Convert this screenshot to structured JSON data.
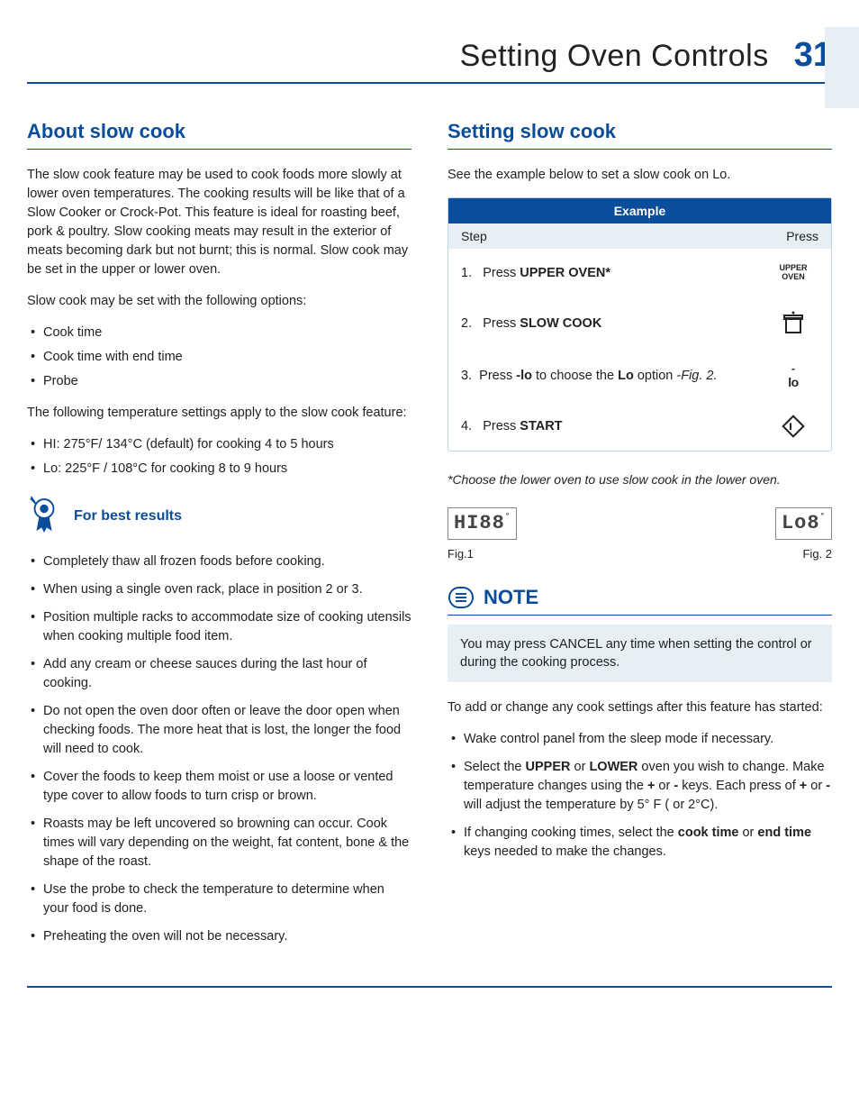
{
  "header": {
    "title": "Setting Oven Controls",
    "page_number": "31"
  },
  "left": {
    "section_title": "About slow cook",
    "intro": "The slow cook feature may be used to cook foods more slowly at lower oven temperatures. The cooking results will be like that of a Slow Cooker or Crock-Pot. This feature is ideal for roasting beef, pork & poultry. Slow cooking meats may result in the exterior of meats becoming dark but not burnt; this is normal. Slow cook may be set in the upper or lower oven.",
    "options_intro": "Slow cook may be set with the following options:",
    "options": [
      "Cook time",
      "Cook time with end time",
      "Probe"
    ],
    "temps_intro": "The following temperature settings apply to the slow cook feature:",
    "temps": [
      "HI: 275°F/ 134°C (default) for cooking 4 to 5 hours",
      "Lo: 225°F / 108°C for cooking 8 to 9 hours"
    ],
    "best_results_title": "For best results",
    "best_results": [
      "Completely thaw all frozen foods before cooking.",
      "When using a single oven rack, place in position 2 or 3.",
      "Position multiple racks to accommodate size of cooking utensils when cooking multiple food item.",
      "Add any cream or cheese sauces during the last hour of cooking.",
      "Do not open the oven door often or leave the door open when checking foods. The more heat that is lost, the longer the food will need to cook.",
      "Cover the foods to keep them moist or use a loose or vented type cover to allow foods to turn crisp or brown.",
      "Roasts may be left uncovered so browning can occur. Cook times will vary depending on the weight, fat content, bone & the shape of the roast.",
      "Use the probe to check the temperature to determine when your food is done.",
      "Preheating the oven will not be necessary."
    ]
  },
  "right": {
    "section_title": "Setting slow cook",
    "intro": "See the example below to set a slow cook on Lo.",
    "table": {
      "title": "Example",
      "col_step": "Step",
      "col_press": "Press",
      "rows": {
        "r1_num": "1.",
        "r1_prefix": "Press ",
        "r1_bold": "UPPER OVEN*",
        "r1_btn_l1": "UPPER",
        "r1_btn_l2": "OVEN",
        "r2_num": "2.",
        "r2_prefix": "Press ",
        "r2_bold": "SLOW COOK",
        "r3_num": "3.",
        "r3_prefix": "Press ",
        "r3_bold1": "-lo",
        "r3_mid": "  to choose the ",
        "r3_bold2": "Lo",
        "r3_suffix": " option ",
        "r3_italic": "-Fig. 2.",
        "r3_btn_top": "-",
        "r3_btn": "lo",
        "r4_num": "4.",
        "r4_prefix": "Press ",
        "r4_bold": "START"
      }
    },
    "footnote": "*Choose the lower oven to use slow cook in the lower oven.",
    "fig1_display": "HI88",
    "fig1_label": "Fig.1",
    "fig2_display": "Lo8",
    "fig2_label": "Fig. 2",
    "note_title": "NOTE",
    "note_body": "You may press CANCEL any time when setting the control or during the cooking process.",
    "after_intro": "To add or change any cook settings after this feature has started:",
    "after_list": {
      "i1": "Wake control panel from the sleep mode if necessary.",
      "i2_a": "Select the ",
      "i2_b1": "UPPER",
      "i2_b": " or ",
      "i2_b2": "LOWER",
      "i2_c": " oven you wish to change. Make temperature changes using the ",
      "i2_plus": "+",
      "i2_d": " or ",
      "i2_minus": "-",
      "i2_e": " keys. Each press of ",
      "i2_plus2": "+",
      "i2_f": " or ",
      "i2_minus2": "-",
      "i2_g": " will adjust the temperature by 5° F ( or 2°C).",
      "i3_a": "If changing cooking times, select the ",
      "i3_b1": "cook time",
      "i3_b": " or ",
      "i3_b2": "end time",
      "i3_c": " keys needed to make the changes."
    }
  }
}
